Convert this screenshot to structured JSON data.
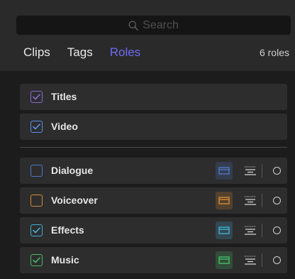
{
  "search": {
    "placeholder": "Search"
  },
  "tabs": [
    {
      "label": "Clips"
    },
    {
      "label": "Tags"
    },
    {
      "label": "Roles",
      "active": true
    }
  ],
  "roles_count": "6 roles",
  "roles": [
    {
      "name": "Titles",
      "checked": true,
      "color": "#8a6bd6"
    },
    {
      "name": "Video",
      "checked": true,
      "color": "#5d8ef0"
    },
    {
      "name": "Dialogue",
      "checked": false,
      "color": "#4e78c8"
    },
    {
      "name": "Voiceover",
      "checked": false,
      "color": "#d88a34"
    },
    {
      "name": "Effects",
      "checked": true,
      "color": "#41aed4"
    },
    {
      "name": "Music",
      "checked": true,
      "color": "#45bd66"
    }
  ],
  "colors": {
    "accent": "#6d6bf5",
    "panel": "#2a2a2a",
    "row": "#2d2d2d"
  },
  "icons": [
    "search-icon",
    "checkmark-icon",
    "lane-icon",
    "subroles-icon",
    "circle-icon"
  ]
}
